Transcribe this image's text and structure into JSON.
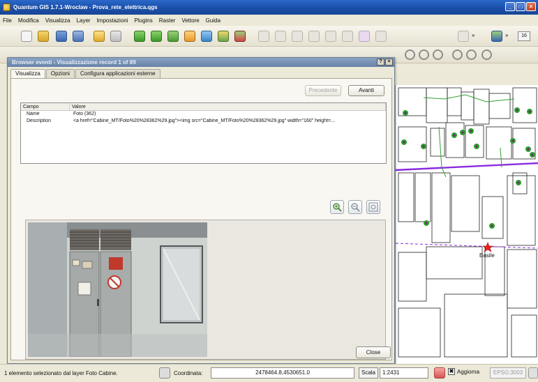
{
  "window": {
    "title": "Quantum GIS 1.7.1-Wroclaw - Prova_rete_elettrica.qgs",
    "controls": [
      "_",
      "□",
      "×"
    ]
  },
  "menu": [
    "File",
    "Modifica",
    "Visualizza",
    "Layer",
    "Impostazioni",
    "Plugins",
    "Raster",
    "Vettore",
    "Guida"
  ],
  "toolbar": {
    "overflow_buttons": [
      "»",
      "»"
    ],
    "zoom_badge": "16"
  },
  "dialog": {
    "title": "Browser eventi - Visualizzazione record 1 of 89",
    "title_controls": [
      "?",
      "×"
    ],
    "tabs": [
      "Visualizza",
      "Opzioni",
      "Configura applicazioni esterne"
    ],
    "active_tab": "Visualizza",
    "prev_label": "Precedente",
    "next_label": "Avanti",
    "table": {
      "headers": [
        "Campo",
        "Valore"
      ],
      "rows": [
        {
          "field": "Name",
          "value": "Foto (362)"
        },
        {
          "field": "Description",
          "value": "<a href=\"Cabine_MT/Foto%20%28362%29.jpg\"><img src=\"Cabine_MT/Foto%20%28362%29.jpg\" width=\"160\" height=..."
        }
      ]
    },
    "zoom_buttons": [
      "zoom-in-icon",
      "zoom-out-icon",
      "zoom-full-icon"
    ],
    "close_label": "Close"
  },
  "map": {
    "label": "Basile",
    "colors": {
      "point": "#2e9e2e",
      "point_center": "#7a1e7a",
      "line": "#8a2be2",
      "selection": "#e82020"
    }
  },
  "status": {
    "message": "1 elemento selezionato dal layer Foto Cabine.",
    "coord_label": "Coordinata:",
    "coord_value": "2478464.8,4530651.0",
    "scale_label": "Scala",
    "scale_value": "1:2431",
    "render_label": "Aggiorna",
    "render_checked": "✖",
    "epsg": "EPSG:3003"
  }
}
